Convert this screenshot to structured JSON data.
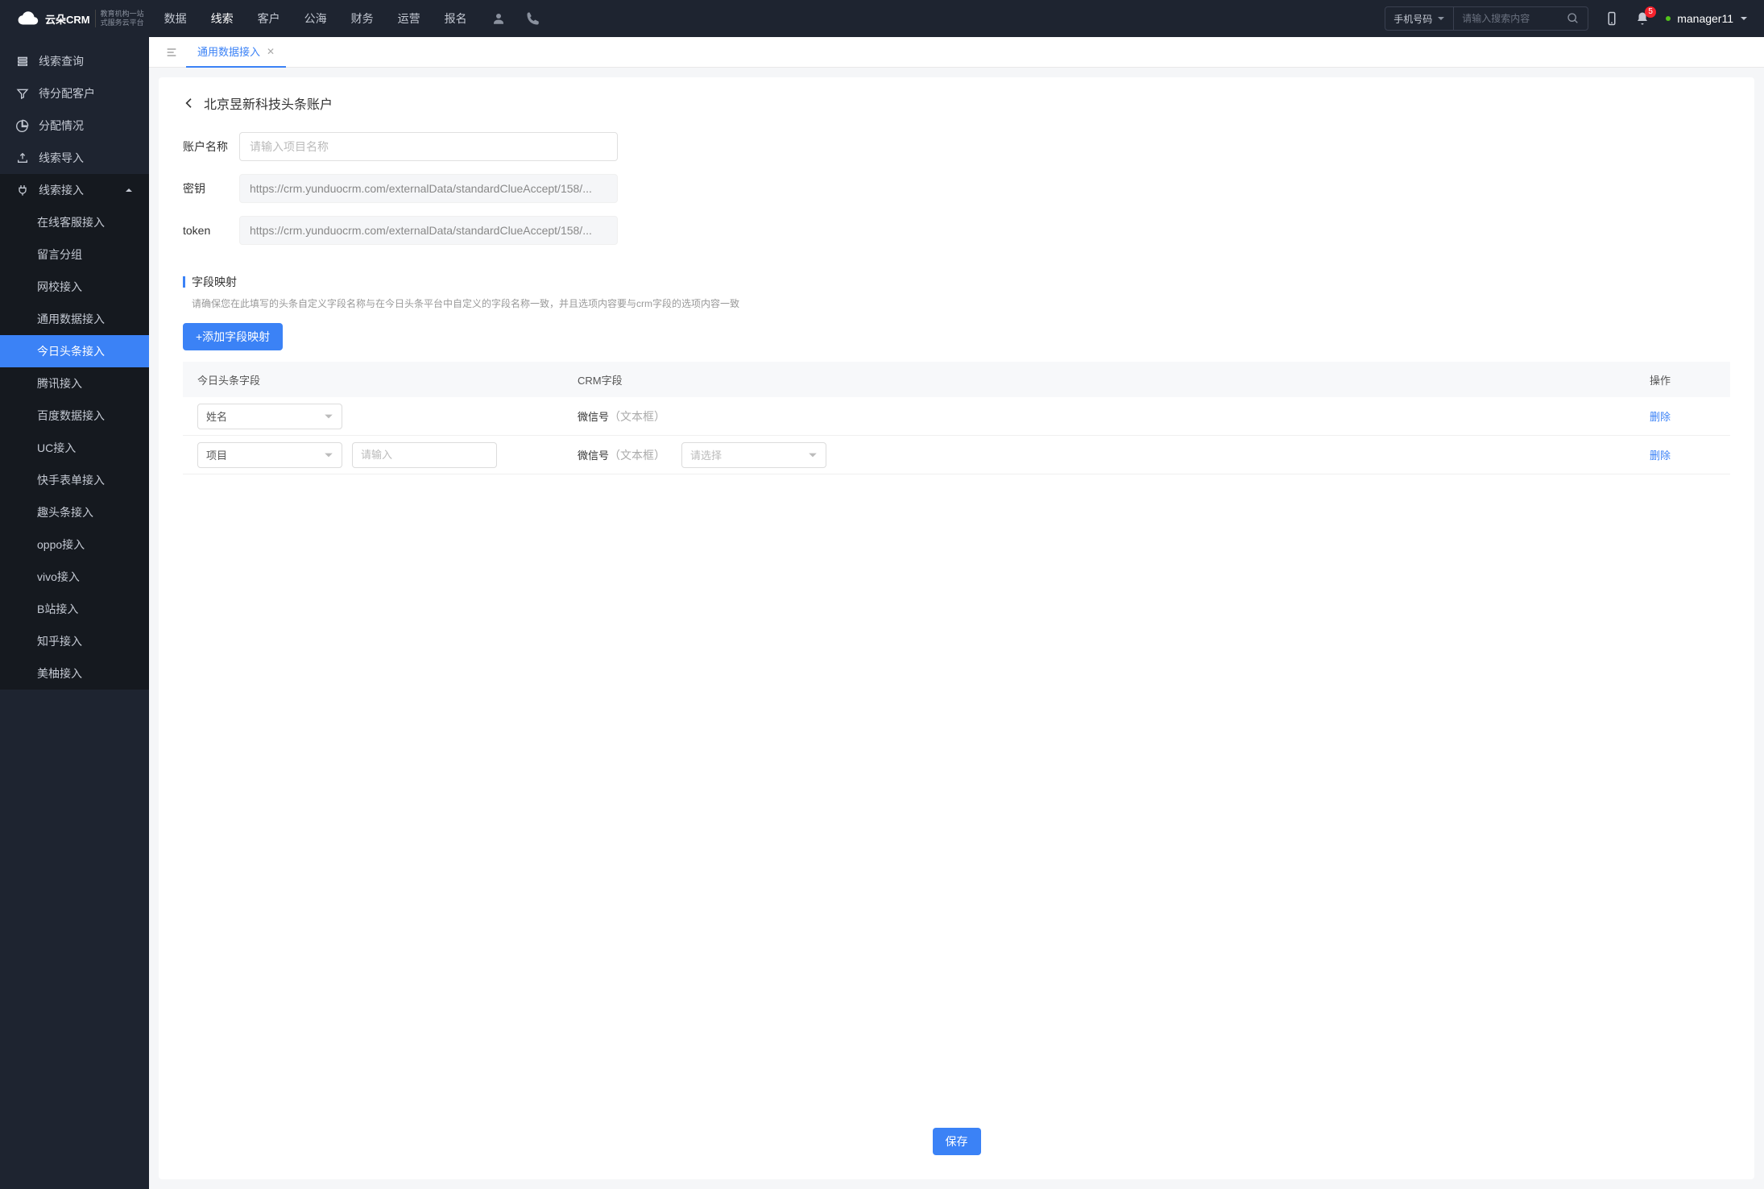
{
  "logo": {
    "brand": "云朵CRM",
    "sub1": "教育机构一站",
    "sub2": "式服务云平台"
  },
  "topnav": [
    "数据",
    "线索",
    "客户",
    "公海",
    "财务",
    "运营",
    "报名"
  ],
  "topnav_active": 1,
  "search": {
    "type_label": "手机号码",
    "placeholder": "请输入搜索内容"
  },
  "notif_count": "5",
  "user": "manager11",
  "sidebar": {
    "items": [
      {
        "label": "线索查询",
        "icon": "list"
      },
      {
        "label": "待分配客户",
        "icon": "filter"
      },
      {
        "label": "分配情况",
        "icon": "pie"
      },
      {
        "label": "线索导入",
        "icon": "upload"
      },
      {
        "label": "线索接入",
        "icon": "plug",
        "open": true,
        "subs": [
          "在线客服接入",
          "留言分组",
          "网校接入",
          "通用数据接入",
          "今日头条接入",
          "腾讯接入",
          "百度数据接入",
          "UC接入",
          "快手表单接入",
          "趣头条接入",
          "oppo接入",
          "vivo接入",
          "B站接入",
          "知乎接入",
          "美柚接入"
        ],
        "active_sub": 4
      }
    ]
  },
  "tabs": [
    {
      "label": "通用数据接入",
      "active": true
    }
  ],
  "page": {
    "title": "北京昱新科技头条账户",
    "form": {
      "name_label": "账户名称",
      "name_placeholder": "请输入项目名称",
      "key_label": "密钥",
      "key_value": "https://crm.yunduocrm.com/externalData/standardClueAccept/158/...",
      "token_label": "token",
      "token_value": "https://crm.yunduocrm.com/externalData/standardClueAccept/158/..."
    },
    "mapping": {
      "title": "字段映射",
      "desc": "请确保您在此填写的头条自定义字段名称与在今日头条平台中自定义的字段名称一致，并且选项内容要与crm字段的选项内容一致",
      "add_btn": "+添加字段映射",
      "cols": [
        "今日头条字段",
        "CRM字段",
        "操作"
      ],
      "rows": [
        {
          "toutiao": "姓名",
          "crm_name": "微信号",
          "crm_type": "（文本框）",
          "del": "删除"
        },
        {
          "toutiao": "项目",
          "extra_input_placeholder": "请输入",
          "crm_name": "微信号",
          "crm_type": "（文本框）",
          "crm_select_placeholder": "请选择",
          "del": "删除"
        }
      ]
    },
    "save_btn": "保存"
  }
}
